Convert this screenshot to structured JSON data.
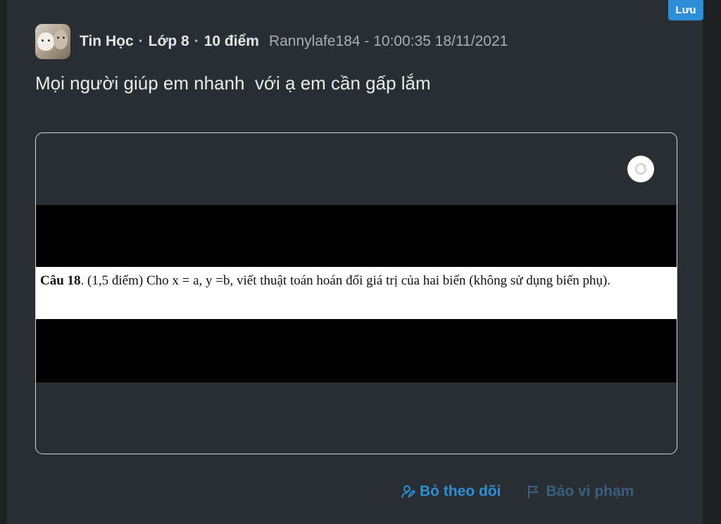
{
  "save_badge": "Lưu",
  "post": {
    "subject": "Tin Học",
    "grade": "Lớp 8",
    "points": "10 điểm",
    "author_time": "Rannylafe184 - 10:00:35 18/11/2021",
    "question": "Mọi người giúp em nhanh  với ạ em cần gấp lắm"
  },
  "attachment": {
    "question_label": "Câu 18",
    "question_body": ". (1,5 điểm) Cho x = a, y =b, viết thuật toán hoán đổi giá trị của hai biến (không sử dụng biến phụ)."
  },
  "actions": {
    "unfollow": "Bỏ theo dõi",
    "report": "Báo vi phạm"
  },
  "colors": {
    "accent": "#2d8fd8",
    "background": "#282e31"
  }
}
